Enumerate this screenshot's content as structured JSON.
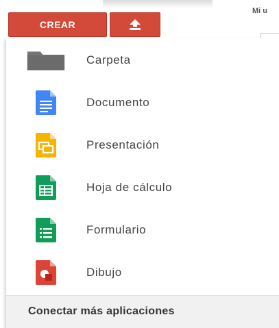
{
  "toolbar": {
    "create_label": "CREAR",
    "upload_icon": "upload-arrow-icon",
    "corner_label": "Mi u"
  },
  "menu": {
    "items": [
      {
        "label": "Carpeta",
        "icon": "folder-icon",
        "color": "#757575"
      },
      {
        "label": "Documento",
        "icon": "document-icon",
        "color": "#4285f4"
      },
      {
        "label": "Presentación",
        "icon": "presentation-icon",
        "color": "#f4b400"
      },
      {
        "label": "Hoja de cálculo",
        "icon": "spreadsheet-icon",
        "color": "#0f9d58"
      },
      {
        "label": "Formulario",
        "icon": "form-icon",
        "color": "#0f9d58"
      },
      {
        "label": "Dibujo",
        "icon": "drawing-icon",
        "color": "#db4437"
      }
    ],
    "footer_label": "Conectar más aplicaciones"
  },
  "colors": {
    "accent": "#d44a38",
    "footer_bg": "#f1f1f1"
  }
}
